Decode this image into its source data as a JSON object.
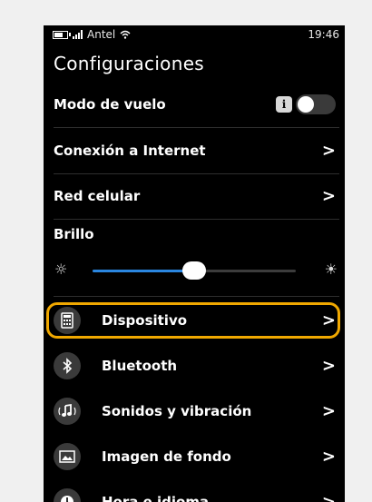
{
  "status_bar": {
    "carrier": "Antel",
    "time": "19:46"
  },
  "title": "Configuraciones",
  "rows": {
    "airplane": {
      "label": "Modo de vuelo",
      "info": "i"
    },
    "internet": {
      "label": "Conexión a Internet",
      "chevron": ">"
    },
    "cellular": {
      "label": "Red celular",
      "chevron": ">"
    }
  },
  "brightness": {
    "label": "Brillo",
    "level": 0.5
  },
  "icon_rows": [
    {
      "label": "Dispositivo",
      "icon": "device-icon",
      "chevron": ">"
    },
    {
      "label": "Bluetooth",
      "icon": "bluetooth-icon",
      "chevron": ">"
    },
    {
      "label": "Sonidos y vibración",
      "icon": "sound-icon",
      "chevron": ">"
    },
    {
      "label": "Imagen de fondo",
      "icon": "wallpaper-icon",
      "chevron": ">"
    },
    {
      "label": "Hora e idioma",
      "icon": "clock-icon",
      "chevron": ">"
    }
  ],
  "colors": {
    "accent": "#2a86e0",
    "highlight": "#f0a800",
    "background": "#000000"
  }
}
